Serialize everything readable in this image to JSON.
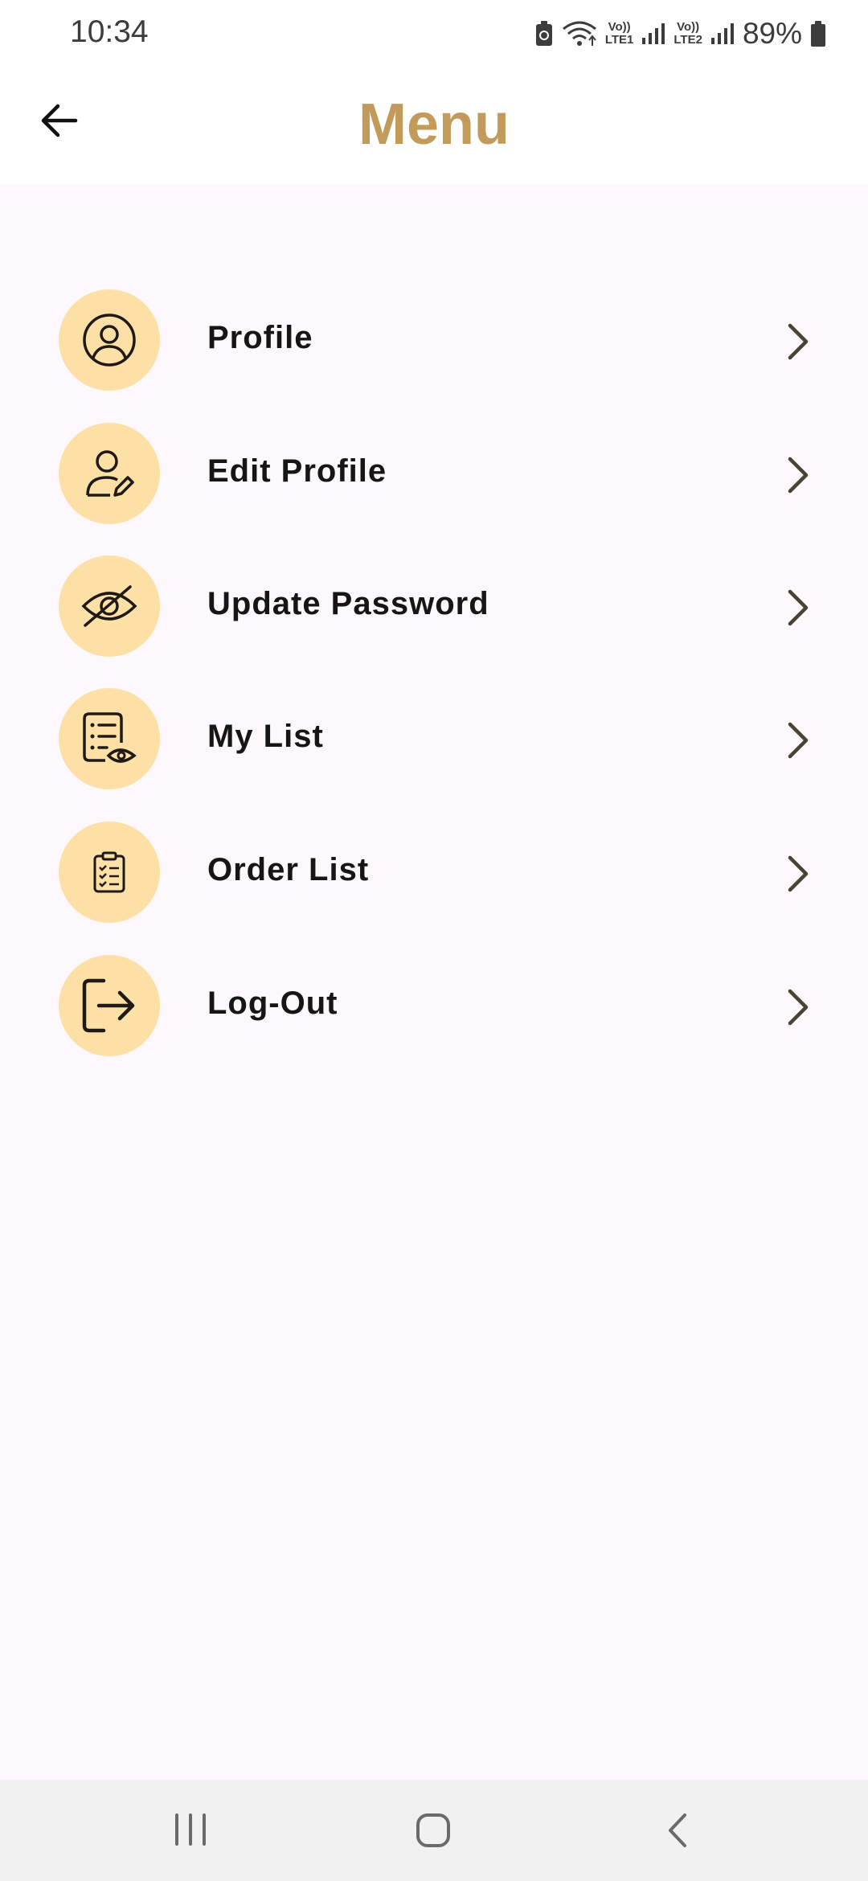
{
  "status_bar": {
    "time": "10:34",
    "lte1_line1": "Vo))",
    "lte1_line2": "LTE1",
    "lte2_line1": "Vo))",
    "lte2_line2": "LTE2",
    "battery": "89%"
  },
  "header": {
    "title": "Menu",
    "title_color": "#c29a5a",
    "back_icon": "arrow-left-icon"
  },
  "menu": {
    "items": [
      {
        "label": "Profile",
        "icon": "user-circle-icon"
      },
      {
        "label": "Edit Profile",
        "icon": "user-edit-icon"
      },
      {
        "label": "Update Password",
        "icon": "eye-off-icon"
      },
      {
        "label": "My List",
        "icon": "list-view-icon"
      },
      {
        "label": "Order List",
        "icon": "clipboard-checklist-icon"
      },
      {
        "label": "Log-Out",
        "icon": "logout-icon"
      }
    ],
    "icon_bg_color": "#fde0a6"
  },
  "nav_bar": {
    "recent_icon": "recent-apps-icon",
    "home_icon": "home-icon",
    "back_icon": "back-icon"
  }
}
